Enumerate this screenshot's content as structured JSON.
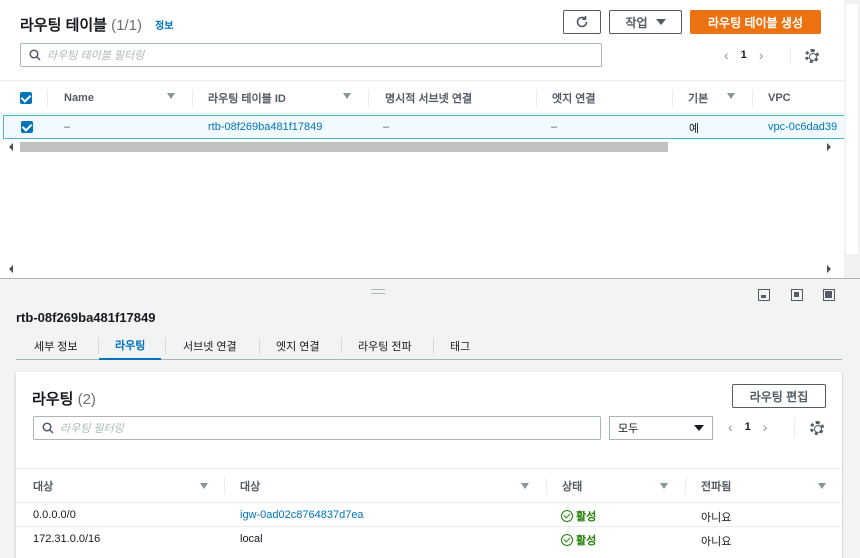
{
  "top": {
    "title": "라우팅 테이블",
    "count": "(1/1)",
    "info": "정보",
    "refresh_icon": "refresh-icon",
    "actions_label": "작업",
    "create_label": "라우팅 테이블 생성",
    "search_placeholder": "라우팅 테이블 필터링",
    "page": "1",
    "columns": [
      "Name",
      "라우팅 테이블 ID",
      "명시적 서브넷 연결",
      "엣지 연결",
      "기본",
      "VPC"
    ],
    "row": {
      "name": "–",
      "id": "rtb-08f269ba481f17849",
      "explicit_subnet": "–",
      "edge": "–",
      "main": "예",
      "vpc": "vpc-0c6dad39"
    }
  },
  "detail": {
    "title": "rtb-08f269ba481f17849",
    "tabs": [
      "세부 정보",
      "라우팅",
      "서브넷 연결",
      "엣지 연결",
      "라우팅 전파",
      "태그"
    ],
    "active_tab": "라우팅",
    "card": {
      "title": "라우팅",
      "count": "(2)",
      "edit_label": "라우팅 편집",
      "search_placeholder": "라우팅 필터링",
      "select_value": "모두",
      "page": "1",
      "columns": [
        "대상",
        "대상",
        "상태",
        "전파됨"
      ],
      "rows": [
        {
          "destination": "0.0.0.0/0",
          "target": "igw-0ad02c8764837d7ea",
          "status": "활성",
          "propagated": "아니요"
        },
        {
          "destination": "172.31.0.0/16",
          "target": "local",
          "status": "활성",
          "propagated": "아니요"
        }
      ]
    }
  },
  "colors": {
    "primary": "#ec7211",
    "link": "#0073bb",
    "active": "#1d8102"
  }
}
